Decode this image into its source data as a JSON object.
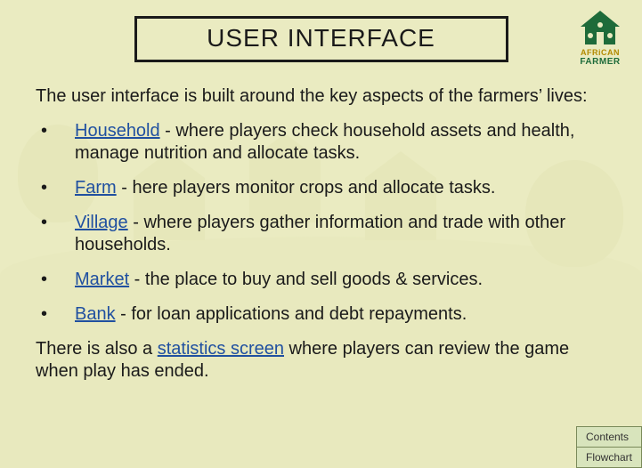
{
  "logo": {
    "line1": "AFRiCAN",
    "line2": "FARMER"
  },
  "title": "USER INTERFACE",
  "intro": "The user interface is built around the key aspects of the farmers’ lives:",
  "items": [
    {
      "link": "Household",
      "rest": " - where players check household assets and health, manage nutrition and allocate tasks."
    },
    {
      "link": "Farm",
      "rest": " - here players monitor crops and allocate tasks."
    },
    {
      "link": "Village",
      "rest": " - where players gather information and trade with other households."
    },
    {
      "link": "Market",
      "rest": " - the place to buy and sell goods & services."
    },
    {
      "link": "Bank",
      "rest": " - for loan applications and debt repayments."
    }
  ],
  "outro": {
    "pre": "There is also a ",
    "link": "statistics screen",
    "post": " where players can review the game when play has ended."
  },
  "nav": {
    "contents": "Contents",
    "flowchart": "Flowchart"
  }
}
